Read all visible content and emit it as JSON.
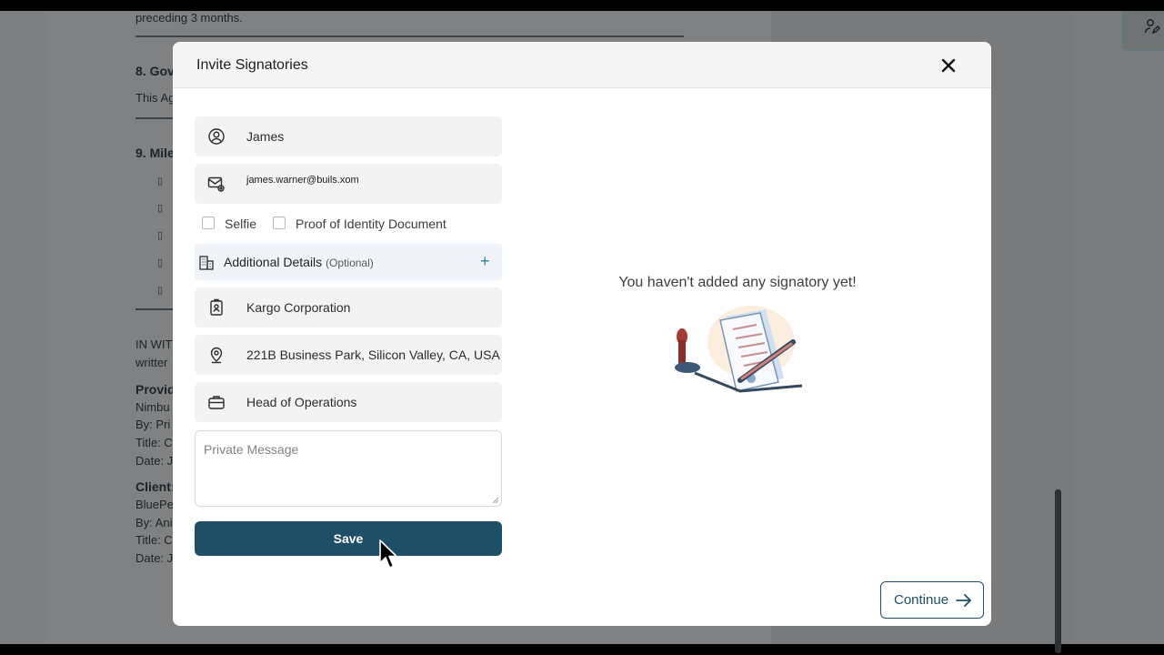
{
  "background_doc": {
    "line1": "preceding 3 months.",
    "heading8": "8. Gov",
    "para8": "This Ag",
    "heading9": "9. Mile",
    "in_witness": "IN WIT",
    "written": "writter",
    "provider_head": "Provide",
    "provider_name": "Nimbu",
    "provider_by": "By: Pri",
    "provider_title": "Title: C",
    "provider_date": "Date: J",
    "client_head": "Client:",
    "client_name": "BluePe",
    "client_by": "By: Ani",
    "client_title": "Title: C",
    "client_date": "Date: J",
    "bullet_glyph": "▯"
  },
  "modal": {
    "title": "Invite Signatories",
    "form": {
      "name_value": "James",
      "email_value": "james.warner@buils.xom",
      "checkbox_selfie": "Selfie",
      "checkbox_id_doc": "Proof of Identity Document",
      "additional_label": "Additional Details",
      "additional_optional": "(Optional)",
      "additional_plus": "+",
      "company_value": "Kargo Corporation",
      "address_value": "221B Business Park, Silicon Valley, CA, USA",
      "position_value": "Head of Operations",
      "message_placeholder": "Private Message",
      "save_label": "Save"
    },
    "empty_state": {
      "message": "You haven't added any signatory yet!"
    },
    "continue_label": "Continue"
  },
  "colors": {
    "primary": "#1f4e67",
    "accent_plus": "#3d7fa3"
  }
}
